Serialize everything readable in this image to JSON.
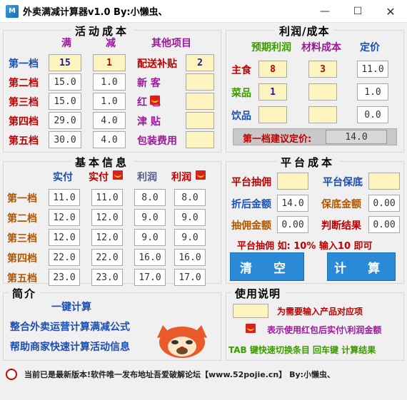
{
  "window": {
    "title": "外卖满减计算器v1.0   By:小懒虫、",
    "controls": [
      "minimize",
      "maximize",
      "close"
    ]
  },
  "activity": {
    "title": "活动成本",
    "col_full": "满",
    "col_minus": "减",
    "col_other": "其他项目",
    "rows": [
      {
        "label": "第一档",
        "full": "15",
        "minus": "1"
      },
      {
        "label": "第二档",
        "full": "15.0",
        "minus": "1.0"
      },
      {
        "label": "第三档",
        "full": "15.0",
        "minus": "1.0"
      },
      {
        "label": "第四档",
        "full": "29.0",
        "minus": "4.0"
      },
      {
        "label": "第五档",
        "full": "30.0",
        "minus": "4.0"
      }
    ],
    "other": [
      {
        "label": "配送补贴",
        "value": "2"
      },
      {
        "label": "新  客",
        "value": ""
      },
      {
        "label": "红   包",
        "value": ""
      },
      {
        "label": "津  贴",
        "value": ""
      },
      {
        "label": "包装费用",
        "value": ""
      }
    ]
  },
  "profit": {
    "title": "利润/成本",
    "col_profit": "预期利润",
    "col_material": "材料成本",
    "col_price": "定价",
    "rows": [
      {
        "label": "主食",
        "profit": "8",
        "material": "3",
        "price": "11.0"
      },
      {
        "label": "菜品",
        "profit": "1",
        "material": "",
        "price": "1.0"
      },
      {
        "label": "饮品",
        "profit": "",
        "material": "",
        "price": "0.0"
      }
    ],
    "suggest_label": "第一档建议定价:",
    "suggest_value": "14.0"
  },
  "basic": {
    "title": "基本信息",
    "headers": [
      "实付",
      "实付",
      "利润",
      "利润"
    ],
    "rows": [
      {
        "label": "第一档",
        "v": [
          "11.0",
          "11.0",
          "8.0",
          "8.0"
        ]
      },
      {
        "label": "第二档",
        "v": [
          "12.0",
          "12.0",
          "9.0",
          "9.0"
        ]
      },
      {
        "label": "第三档",
        "v": [
          "12.0",
          "12.0",
          "9.0",
          "9.0"
        ]
      },
      {
        "label": "第四档",
        "v": [
          "22.0",
          "22.0",
          "16.0",
          "16.0"
        ]
      },
      {
        "label": "第五档",
        "v": [
          "23.0",
          "23.0",
          "17.0",
          "17.0"
        ]
      }
    ]
  },
  "platform": {
    "title": "平台成本",
    "commission_label": "平台抽佣",
    "guarantee_label": "平台保底",
    "discounted_label": "折后金额",
    "discounted_value": "14.0",
    "guarantee_amount_label": "保底金额",
    "guarantee_amount_value": "0.00",
    "commission_amount_label": "抽佣金额",
    "commission_amount_value": "0.00",
    "result_label": "判断结果",
    "result_value": "0.00",
    "hint": "平台抽佣 如: 10% 输入10 即可",
    "clear_button": "清 空",
    "calc_button": "计 算"
  },
  "intro": {
    "title": "简介",
    "line1": "一键计算",
    "line2": "整合外卖运营计算满减公式",
    "line3": "帮助商家快速计算活动信息"
  },
  "usage": {
    "title": "使用说明",
    "item1": "为需要输入产品对应项",
    "item2": "表示使用红包后实付\\利润金额",
    "item3": "TAB 键快速切换条目  回车键  计算结果"
  },
  "status": {
    "text": "当前已是最新版本!软件唯一发布地址吾爱破解论坛【www.52pojie.cn】   By:小懒虫、"
  }
}
